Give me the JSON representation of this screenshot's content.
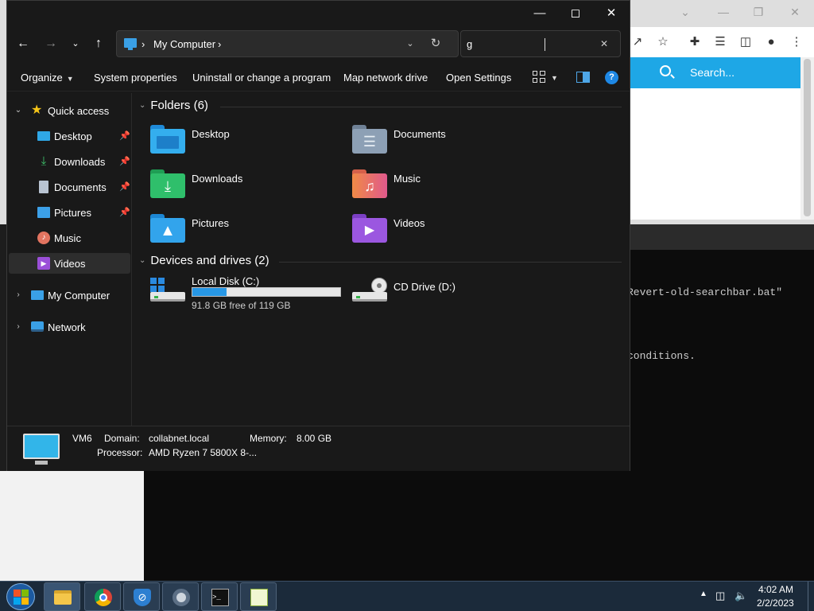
{
  "background": {
    "browser": {
      "search_placeholder": "Search...",
      "toolbar_icons": [
        "share-icon",
        "star-icon",
        "extensions-icon",
        "media-icon",
        "sidebar-icon",
        "profile-icon",
        "menu-icon"
      ]
    },
    "terminal": {
      "line1": "Revert-old-searchbar.bat\"",
      "line2": "conditions."
    }
  },
  "window": {
    "controls": [
      "minimize",
      "maximize",
      "close"
    ]
  },
  "address": {
    "location": "My Computer",
    "search_value": "g"
  },
  "commands": {
    "organize": "Organize",
    "system_properties": "System properties",
    "uninstall": "Uninstall or change a program",
    "map_drive": "Map network drive",
    "open_settings": "Open Settings",
    "help": "?"
  },
  "nav_pane": {
    "quick_access": "Quick access",
    "items": [
      {
        "label": "Desktop",
        "pinned": true
      },
      {
        "label": "Downloads",
        "pinned": true
      },
      {
        "label": "Documents",
        "pinned": true
      },
      {
        "label": "Pictures",
        "pinned": true
      },
      {
        "label": "Music",
        "pinned": false
      },
      {
        "label": "Videos",
        "pinned": false,
        "selected": true
      }
    ],
    "my_computer": "My Computer",
    "network": "Network"
  },
  "content": {
    "folders_header": "Folders (6)",
    "folders": [
      "Desktop",
      "Documents",
      "Downloads",
      "Music",
      "Pictures",
      "Videos"
    ],
    "drives_header": "Devices and drives (2)",
    "drives": [
      {
        "name": "Local Disk (C:)",
        "free_text": "91.8 GB free of 119 GB",
        "used_fraction": 0.23
      },
      {
        "name": "CD Drive (D:)"
      }
    ]
  },
  "details": {
    "computer_name": "VM6",
    "domain_label": "Domain:",
    "domain_value": "collabnet.local",
    "memory_label": "Memory:",
    "memory_value": "8.00 GB",
    "processor_label": "Processor:",
    "processor_value": "AMD Ryzen 7 5800X 8-..."
  },
  "taskbar": {
    "apps": [
      "file-explorer",
      "chrome",
      "shield-app",
      "settings-app",
      "terminal",
      "notepad-app"
    ],
    "clock_time": "4:02 AM",
    "clock_date": "2/2/2023"
  },
  "colors": {
    "accent": "#1ea7e6",
    "window_bg": "#191919",
    "capacity_fill": "#2797e5"
  }
}
